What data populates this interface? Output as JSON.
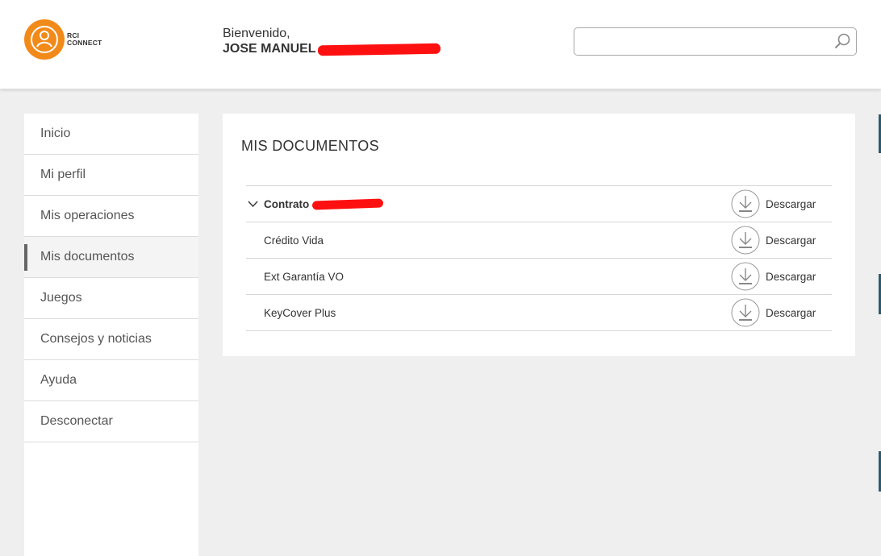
{
  "header": {
    "logo": {
      "line1": "RCI",
      "line2": "CONNECT",
      "brand_color": "#f28a1a"
    },
    "welcome": {
      "greeting": "Bienvenido,",
      "name": "JOSE MANUEL"
    },
    "search": {
      "value": "",
      "placeholder": "",
      "icon": "search-icon"
    }
  },
  "sidebar": {
    "items": [
      {
        "label": "Inicio",
        "active": false
      },
      {
        "label": "Mi perfil",
        "active": false
      },
      {
        "label": "Mis operaciones",
        "active": false
      },
      {
        "label": "Mis documentos",
        "active": true
      },
      {
        "label": "Juegos",
        "active": false
      },
      {
        "label": "Consejos y noticias",
        "active": false
      },
      {
        "label": "Ayuda",
        "active": false
      },
      {
        "label": "Desconectar",
        "active": false
      }
    ]
  },
  "main": {
    "title": "MIS DOCUMENTOS",
    "documents": [
      {
        "label": "Contrato",
        "expanded": true,
        "action": "Descargar"
      },
      {
        "label": "Crédito Vida",
        "action": "Descargar"
      },
      {
        "label": "Ext Garantía VO",
        "action": "Descargar"
      },
      {
        "label": "KeyCover Plus",
        "action": "Descargar"
      }
    ]
  },
  "colors": {
    "redaction": "#ff1010",
    "accent_edge": "#2c5a6e"
  }
}
